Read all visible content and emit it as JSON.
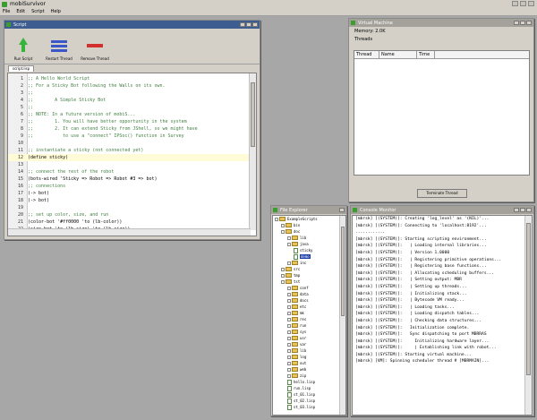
{
  "app": {
    "title": "mobiSurvivor"
  },
  "menu": [
    "File",
    "Edit",
    "Script",
    "Help"
  ],
  "script_window": {
    "title": "Script",
    "toolbar": [
      {
        "label": "Run Script",
        "icon": "run-arrow-icon"
      },
      {
        "label": "Restart Thread",
        "icon": "restart-icon"
      },
      {
        "label": "Remove Thread",
        "icon": "reset-icon"
      }
    ],
    "tab": "script.lisp",
    "lines": [
      {
        "n": "1",
        "text": ";; A Hello World Script",
        "type": "comment"
      },
      {
        "n": "2",
        "text": ";; For a Sticky Bot following the Walls on its own.",
        "type": "comment"
      },
      {
        "n": "3",
        "text": ";;",
        "type": "comment"
      },
      {
        "n": "4",
        "text": ";;        A Simple Sticky Bot",
        "type": "comment"
      },
      {
        "n": "5",
        "text": ";;",
        "type": "comment"
      },
      {
        "n": "6",
        "text": ";; NOTE: In a future version of mobiS...",
        "type": "comment"
      },
      {
        "n": "7",
        "text": ";;        1. You will have better opportunity in the system",
        "type": "comment"
      },
      {
        "n": "8",
        "text": ";;        2. It can extend Sticky from JShell, so we might have",
        "type": "comment"
      },
      {
        "n": "9",
        "text": ";;           to use a \"connect\" IPSoc() function in Survey",
        "type": "comment"
      },
      {
        "n": "10",
        "text": "",
        "type": "code"
      },
      {
        "n": "11",
        "text": ";; instantiate a sticky (not connected yet)",
        "type": "comment"
      },
      {
        "n": "12",
        "text": "(define sticky)",
        "type": "code"
      },
      {
        "n": "13",
        "text": "",
        "type": "code"
      },
      {
        "n": "14",
        "text": ";; connect the rest of the robot",
        "type": "comment"
      },
      {
        "n": "15",
        "text": "(bots-wired 'Sticky => Robot => Robot #3 => bot)",
        "type": "code"
      },
      {
        "n": "16",
        "text": ";; connections",
        "type": "comment"
      },
      {
        "n": "17",
        "text": "(-> bot)",
        "type": "code"
      },
      {
        "n": "18",
        "text": "(-> bot)",
        "type": "code"
      },
      {
        "n": "19",
        "text": "",
        "type": "code"
      },
      {
        "n": "20",
        "text": ";; set up color, size, and run",
        "type": "comment"
      },
      {
        "n": "21",
        "text": "(color-bot '#ff0000 'to (lb-color))",
        "type": "code"
      },
      {
        "n": "22",
        "text": "(size-bot 'to (lb-size) 'to (lb-size))",
        "type": "code"
      },
      {
        "n": "23",
        "text": "(-> (run-bot))",
        "type": "code"
      }
    ]
  },
  "vm_window": {
    "title": "Virtual Machine",
    "memory": "Memory: 2.0K",
    "threads": "Threads",
    "columns": [
      "Thread",
      "Name",
      "Time"
    ],
    "button": "Terminate Thread"
  },
  "explorer_window": {
    "title": "File Explorer",
    "items": [
      {
        "label": "ExampleScripts",
        "kind": "folder",
        "depth": 0
      },
      {
        "label": "bin",
        "kind": "folder",
        "depth": 1
      },
      {
        "label": "doc",
        "kind": "folder",
        "depth": 1
      },
      {
        "label": "lib",
        "kind": "folder",
        "depth": 2
      },
      {
        "label": "java",
        "kind": "folder",
        "depth": 2
      },
      {
        "label": "sticky",
        "kind": "file",
        "depth": 3
      },
      {
        "label": "demo",
        "kind": "file",
        "depth": 3,
        "selected": true
      },
      {
        "label": "inc",
        "kind": "folder",
        "depth": 2
      },
      {
        "label": "src",
        "kind": "folder",
        "depth": 1
      },
      {
        "label": "tmp",
        "kind": "folder",
        "depth": 1
      },
      {
        "label": "tst",
        "kind": "folder",
        "depth": 1
      },
      {
        "label": "conf",
        "kind": "folder",
        "depth": 2
      },
      {
        "label": "data",
        "kind": "folder",
        "depth": 2
      },
      {
        "label": "docs",
        "kind": "folder",
        "depth": 2
      },
      {
        "label": "etc",
        "kind": "folder",
        "depth": 2
      },
      {
        "label": "mk",
        "kind": "folder",
        "depth": 2
      },
      {
        "label": "res",
        "kind": "folder",
        "depth": 2
      },
      {
        "label": "run",
        "kind": "folder",
        "depth": 2
      },
      {
        "label": "sys",
        "kind": "folder",
        "depth": 2
      },
      {
        "label": "usr",
        "kind": "folder",
        "depth": 2
      },
      {
        "label": "var",
        "kind": "folder",
        "depth": 2
      },
      {
        "label": "lib",
        "kind": "folder",
        "depth": 2
      },
      {
        "label": "log",
        "kind": "folder",
        "depth": 2
      },
      {
        "label": "out",
        "kind": "folder",
        "depth": 2
      },
      {
        "label": "web",
        "kind": "folder",
        "depth": 2
      },
      {
        "label": "zip",
        "kind": "folder",
        "depth": 2
      },
      {
        "label": "hello.lisp",
        "kind": "file",
        "depth": 2
      },
      {
        "label": "run.lisp",
        "kind": "file",
        "depth": 2
      },
      {
        "label": "st_01.lisp",
        "kind": "file",
        "depth": 2
      },
      {
        "label": "st_02.lisp",
        "kind": "file",
        "depth": 2
      },
      {
        "label": "st_03.lisp",
        "kind": "file",
        "depth": 2
      }
    ]
  },
  "console_window": {
    "title": "Console Monitor",
    "lines": [
      "[mbrsk] [(SYSTEM)]: Creating 'log_level' as '(NIL)'...",
      "[mbrsk] [(SYSTEM)]: Connecting to 'localhost:8192'...",
      "............",
      "[mbrsk] [(SYSTEM)]: Starting scripting environment...",
      "[mbrsk] [(SYSTEM)]:   | Loading internal libraries...",
      "[mbrsk] [(SYSTEM)]:   | Version 1.0000",
      "[mbrsk] [(SYSTEM)]:   | Registering primitive operations...",
      "[mbrsk] [(SYSTEM)]:   | Registering base functions...",
      "[mbrsk] [(SYSTEM)]:   | Allocating scheduling buffers...",
      "[mbrsk] [(SYSTEM)]:   | Setting output: MBR",
      "[mbrsk] [(SYSTEM)]:   | Setting up threads...",
      "[mbrsk] [(SYSTEM)]:   | Initializing stack...",
      "[mbrsk] [(SYSTEM)]:   | Bytecode VM ready...",
      "[mbrsk] [(SYSTEM)]:   | Loading tasks...",
      "[mbrsk] [(SYSTEM)]:   | Loading dispatch tables...",
      "[mbrsk] [(SYSTEM)]:   | Checking data structures...",
      "[mbrsk] [(SYSTEM)]:   Initialization complete.",
      "[mbrsk] [(SYSTEM)]:   Sync dispatching to port MBRRAS",
      "[mbrsk] [(SYSTEM)]:     Initializing hardware layer...",
      "[mbrsk] [(SYSTEM)]:     | Establishing link with robot...",
      "[mbrsk] [(SYSTEM)]: Starting virtual machine...",
      "[mbrsk] [VM]: Spinning scheduler thread # [MBRMAIN]..."
    ]
  }
}
